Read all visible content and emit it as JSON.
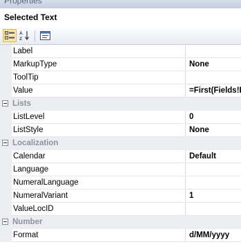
{
  "window": {
    "title": "Properties"
  },
  "object_name": "Selected Text",
  "toolbar": {
    "buttons": [
      {
        "name": "categorized-icon",
        "active": true
      },
      {
        "name": "alphabetical-icon",
        "active": false
      },
      {
        "name": "property-pages-icon",
        "active": false
      }
    ]
  },
  "grid": {
    "general": [
      {
        "name": "Label",
        "value": ""
      },
      {
        "name": "MarkupType",
        "value": "None"
      },
      {
        "name": "ToolTip",
        "value": ""
      },
      {
        "name": "Value",
        "value": "=First(Fields!F"
      }
    ],
    "lists": {
      "label": "Lists",
      "items": [
        {
          "name": "ListLevel",
          "value": "0"
        },
        {
          "name": "ListStyle",
          "value": "None"
        }
      ]
    },
    "localization": {
      "label": "Localization",
      "items": [
        {
          "name": "Calendar",
          "value": "Default"
        },
        {
          "name": "Language",
          "value": ""
        },
        {
          "name": "NumeralLanguage",
          "value": ""
        },
        {
          "name": "NumeralVariant",
          "value": "1"
        },
        {
          "name": "ValueLocID",
          "value": ""
        }
      ]
    },
    "number": {
      "label": "Number",
      "items": [
        {
          "name": "Format",
          "value": "d/MM/yyyy"
        }
      ]
    }
  }
}
